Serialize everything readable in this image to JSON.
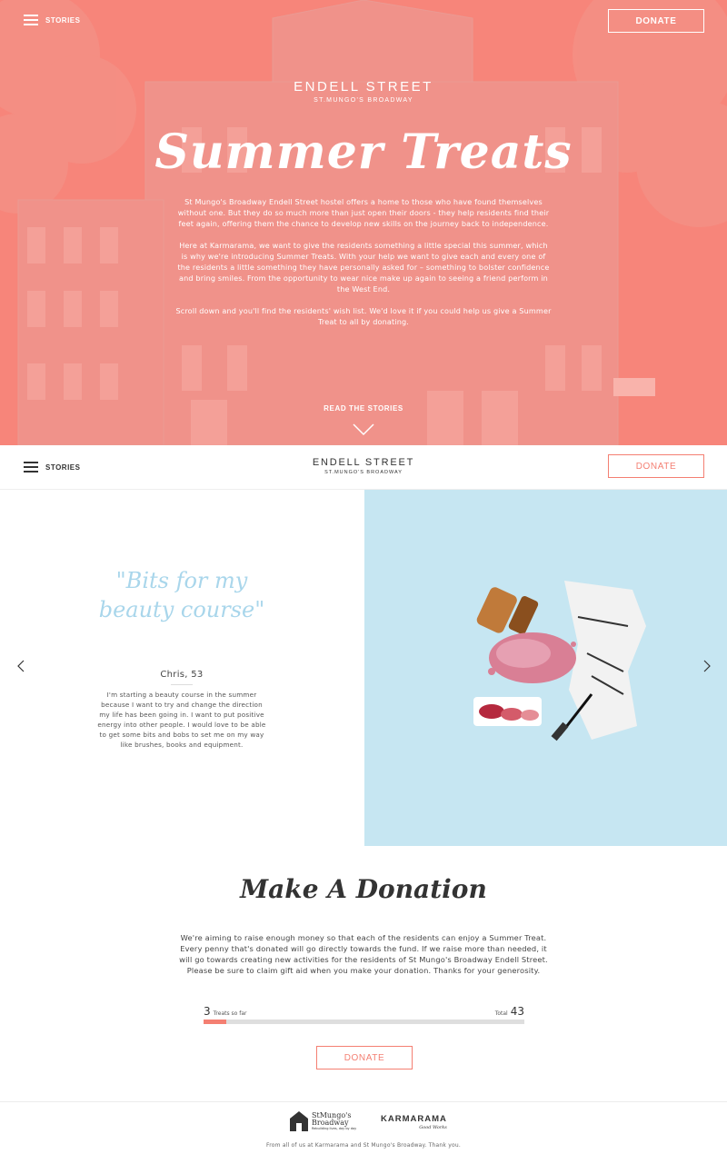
{
  "hero": {
    "stories_label": "STORIES",
    "donate_label": "DONATE",
    "brand_title": "ENDELL STREET",
    "brand_subtitle": "ST.MUNGO'S BROADWAY",
    "title": "Summer Treats",
    "paragraphs": [
      "St Mungo's Broadway Endell Street hostel offers a home to those who have found themselves without one. But they do so much more than just open their doors - they help residents find their feet again, offering them the chance to develop new skills on the journey back to independence.",
      "Here at Karmarama, we want to give the residents something a little special this summer, which is why we're introducing Summer Treats. With your help we want to give each and every one of the residents a little something they have personally asked for – something to bolster confidence and bring smiles. From the opportunity to wear nice make up again to seeing a friend perform in the West End.",
      "Scroll down and you'll find the residents' wish list. We'd love it if you could help us give a Summer Treat to all by donating."
    ],
    "read_stories_label": "READ THE STORIES",
    "overlay_color": "#f7857a"
  },
  "navbar": {
    "stories_label": "STORIES",
    "brand_title": "ENDELL STREET",
    "brand_subtitle": "ST.MUNGO'S BROADWAY",
    "donate_label": "DONATE",
    "accent_color": "#f47f72"
  },
  "story": {
    "quote": "\"Bits for my beauty course\"",
    "person": "Chris, 53",
    "text": "I'm starting a beauty course in the summer because I want to try and change the direction my life has been going in. I want to put positive energy into other people. I would love to be able to get some bits and bobs to set me on my way like brushes, books and equipment.",
    "image_bg_color": "#c6e6f2",
    "prev_icon": "chevron-left-icon",
    "next_icon": "chevron-right-icon"
  },
  "donation": {
    "title": "Make A Donation",
    "text": "We're aiming to raise enough money so that each of the residents can enjoy a Summer Treat. Every penny that's donated will go directly towards the fund. If we raise more than needed, it will go towards creating new activities for the residents of St Mungo's Broadway Endell Street. Please be sure to claim gift aid when you make your donation. Thanks for your generosity.",
    "so_far_value": "3",
    "so_far_label": "Treats so far",
    "total_label": "Total",
    "total_value": "43",
    "progress_fraction": 0.0698,
    "donate_label": "DONATE"
  },
  "footer": {
    "stmungos_logo_line1": "StMungo's",
    "stmungos_logo_line2": "Broadway",
    "stmungos_tagline": "Rebuilding lives, day by day",
    "karmarama_logo": "KARMARAMA",
    "karmarama_tagline": "Good Works",
    "text": "From all of us at Karmarama and St Mungo's Broadway. Thank you."
  }
}
